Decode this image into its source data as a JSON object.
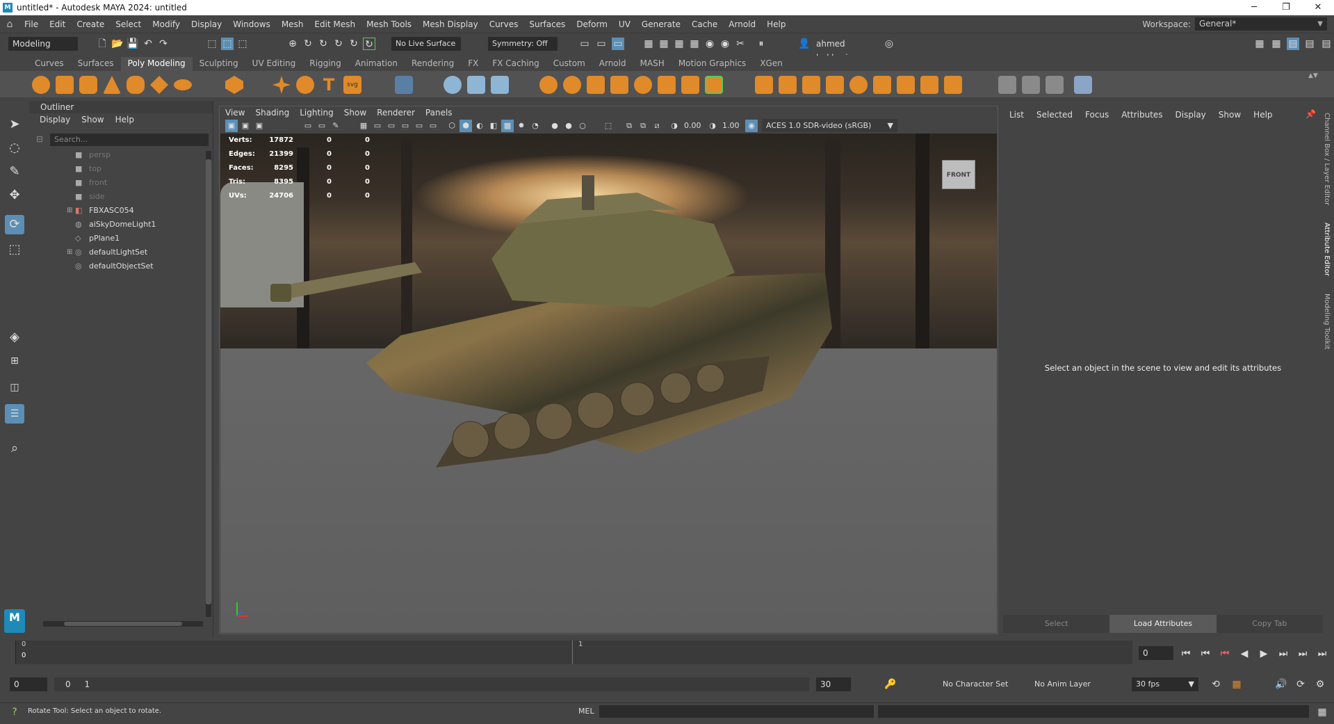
{
  "window": {
    "title": "untitled* - Autodesk MAYA 2024: untitled",
    "min": "─",
    "max": "❐",
    "close": "✕"
  },
  "menu": [
    "File",
    "Edit",
    "Create",
    "Select",
    "Modify",
    "Display",
    "Windows",
    "Mesh",
    "Edit Mesh",
    "Mesh Tools",
    "Mesh Display",
    "Curves",
    "Surfaces",
    "Deform",
    "UV",
    "Generate",
    "Cache",
    "Arnold",
    "Help"
  ],
  "workspace": {
    "label": "Workspace:",
    "value": "General*"
  },
  "statusline": {
    "mode": "Modeling",
    "live_surface": "No Live Surface",
    "symmetry": "Symmetry: Off",
    "user": "ahmed bukhari"
  },
  "shelf_tabs": [
    "Curves",
    "Surfaces",
    "Poly Modeling",
    "Sculpting",
    "UV Editing",
    "Rigging",
    "Animation",
    "Rendering",
    "FX",
    "FX Caching",
    "Custom",
    "Arnold",
    "MASH",
    "Motion Graphics",
    "XGen"
  ],
  "shelf_active": "Poly Modeling",
  "outliner": {
    "title": "Outliner",
    "menu": [
      "Display",
      "Show",
      "Help"
    ],
    "search_placeholder": "Search...",
    "items": [
      {
        "label": "persp",
        "icon": "camera-icon",
        "dim": true
      },
      {
        "label": "top",
        "icon": "camera-icon",
        "dim": true
      },
      {
        "label": "front",
        "icon": "camera-icon",
        "dim": true
      },
      {
        "label": "side",
        "icon": "camera-icon",
        "dim": true
      },
      {
        "label": "FBXASC054",
        "icon": "group-icon",
        "dim": false,
        "expand": true
      },
      {
        "label": "aiSkyDomeLight1",
        "icon": "light-icon",
        "dim": false
      },
      {
        "label": "pPlane1",
        "icon": "mesh-icon",
        "dim": false
      },
      {
        "label": "defaultLightSet",
        "icon": "set-icon",
        "dim": false,
        "expand": true
      },
      {
        "label": "defaultObjectSet",
        "icon": "set-icon",
        "dim": false
      }
    ]
  },
  "viewport": {
    "menu": [
      "View",
      "Shading",
      "Lighting",
      "Show",
      "Renderer",
      "Panels"
    ],
    "exposure": "0.00",
    "gamma": "1.00",
    "color_space": "ACES 1.0 SDR-video (sRGB)",
    "viewcube": "FRONT",
    "hud": [
      {
        "label": "Verts:",
        "v1": "17872",
        "v2": "0",
        "v3": "0"
      },
      {
        "label": "Edges:",
        "v1": "21399",
        "v2": "0",
        "v3": "0"
      },
      {
        "label": "Faces:",
        "v1": "8295",
        "v2": "0",
        "v3": "0"
      },
      {
        "label": "Tris:",
        "v1": "8395",
        "v2": "0",
        "v3": "0"
      },
      {
        "label": "UVs:",
        "v1": "24706",
        "v2": "0",
        "v3": "0"
      }
    ]
  },
  "attr_editor": {
    "menu": [
      "List",
      "Selected",
      "Focus",
      "Attributes",
      "Display",
      "Show",
      "Help"
    ],
    "message": "Select an object in the scene to view and edit its attributes",
    "buttons": [
      "Select",
      "Load Attributes",
      "Copy Tab"
    ],
    "tabs": [
      "Channel Box / Layer Editor",
      "Attribute Editor",
      "Modeling Toolkit"
    ]
  },
  "time": {
    "frame_top": "0",
    "frame_bot": "0",
    "marker": "1",
    "current": "0",
    "start": "0",
    "range_start": "0",
    "range_mid": "1",
    "end": "30",
    "char_set": "No Character Set",
    "anim_layer": "No Anim Layer",
    "fps": "30 fps"
  },
  "cmd": {
    "lang": "MEL",
    "help": "Rotate Tool: Select an object to rotate."
  },
  "colors": {
    "accent": "#5b8fb5",
    "shelf_orange": "#e08a2a",
    "maya_blue": "#1f8ab8"
  }
}
